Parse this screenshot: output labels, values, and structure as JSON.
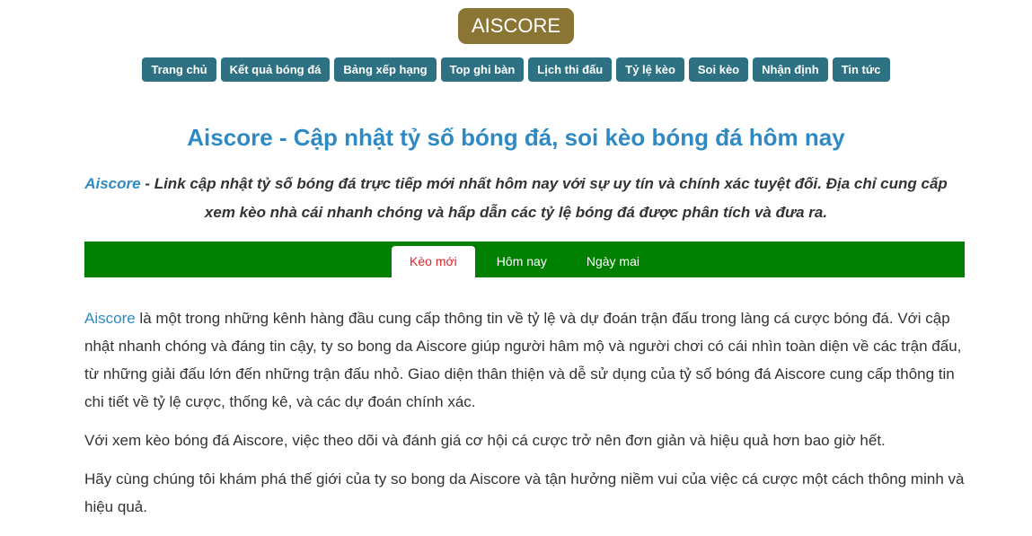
{
  "logo": {
    "text": "AISCORE"
  },
  "nav": [
    {
      "label": "Trang chủ"
    },
    {
      "label": "Kết quả bóng đá"
    },
    {
      "label": "Bảng xếp hạng"
    },
    {
      "label": "Top ghi bàn"
    },
    {
      "label": "Lịch thi đấu"
    },
    {
      "label": "Tỷ lệ kèo"
    },
    {
      "label": "Soi kèo"
    },
    {
      "label": "Nhận định"
    },
    {
      "label": "Tin tức"
    }
  ],
  "page": {
    "title": "Aiscore - Cập nhật tỷ số bóng đá, soi kèo bóng đá hôm nay",
    "intro_link": "Aiscore",
    "intro_text": " - Link cập nhật tỷ số bóng đá trực tiếp mới nhất hôm nay với sự uy tín và chính xác tuyệt đối. Địa chỉ cung cấp xem kèo nhà cái nhanh chóng và hấp dẫn các tỷ lệ bóng đá được phân tích và đưa ra."
  },
  "tabs": [
    {
      "label": "Kèo mới",
      "active": true
    },
    {
      "label": "Hôm nay",
      "active": false
    },
    {
      "label": "Ngày mai",
      "active": false
    }
  ],
  "content": {
    "p1_link": "Aiscore",
    "p1_text": " là một trong những kênh hàng đầu cung cấp thông tin về tỷ lệ và dự đoán trận đấu trong làng cá cược bóng đá. Với cập nhật nhanh chóng và đáng tin cậy, ty so bong da Aiscore giúp người hâm mộ và người chơi có cái nhìn toàn diện về các trận đấu, từ những giải đấu lớn đến những trận đấu nhỏ. Giao diện thân thiện và dễ sử dụng của tỷ số bóng đá Aiscore cung cấp thông tin chi tiết về tỷ lệ cược, thống kê, và các dự đoán chính xác.",
    "p2": "Với xem kèo bóng đá Aiscore, việc theo dõi và đánh giá cơ hội cá cược trở nên đơn giản và hiệu quả hơn bao giờ hết.",
    "p3": "Hãy cùng chúng tôi khám phá thế giới của ty so bong da Aiscore và tận hưởng niềm vui của việc cá cược một cách thông minh và hiệu quả."
  },
  "colors": {
    "logo_bg": "#8b7535",
    "nav_bg": "#2d7182",
    "title": "#2f8ac4",
    "tabbar_bg": "#008000",
    "active_tab_text": "#d6262c"
  }
}
